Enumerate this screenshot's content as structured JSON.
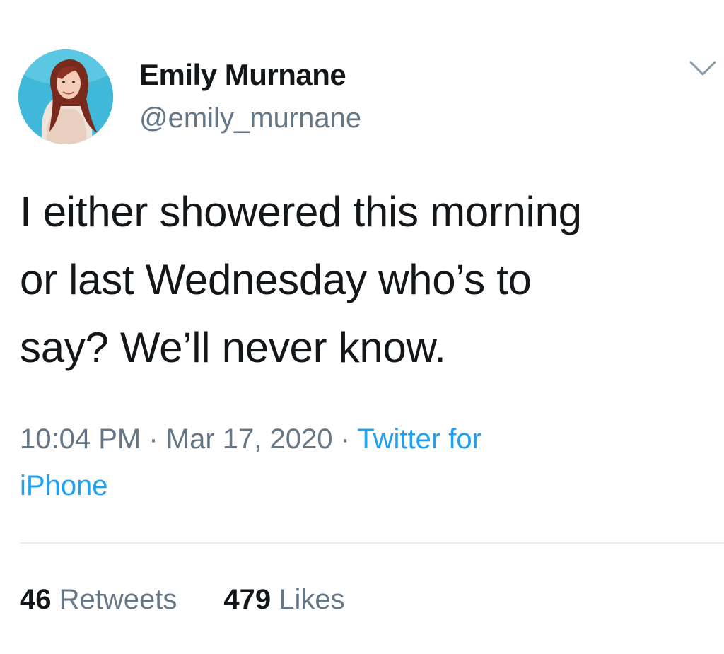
{
  "user": {
    "display_name": "Emily Murnane",
    "handle": "@emily_murnane",
    "avatar": "profile-photo"
  },
  "tweet": {
    "lines": [
      "I either showered this morning",
      "or last Wednesday who’s to",
      "say? We’ll never know."
    ]
  },
  "meta": {
    "time": "10:04 PM",
    "separator": "·",
    "date": "Mar 17, 2020",
    "source_line1": "Twitter for",
    "source_line2": "iPhone"
  },
  "stats": {
    "retweets_count": "46",
    "retweets_label": "Retweets",
    "likes_count": "479",
    "likes_label": "Likes"
  },
  "icons": {
    "menu": "chevron-down-icon"
  },
  "colors": {
    "text": "#14171a",
    "secondary": "#657786",
    "link": "#1da1f2",
    "divider": "#e6ecf0",
    "avatar_bg": "#3fb8d9"
  }
}
